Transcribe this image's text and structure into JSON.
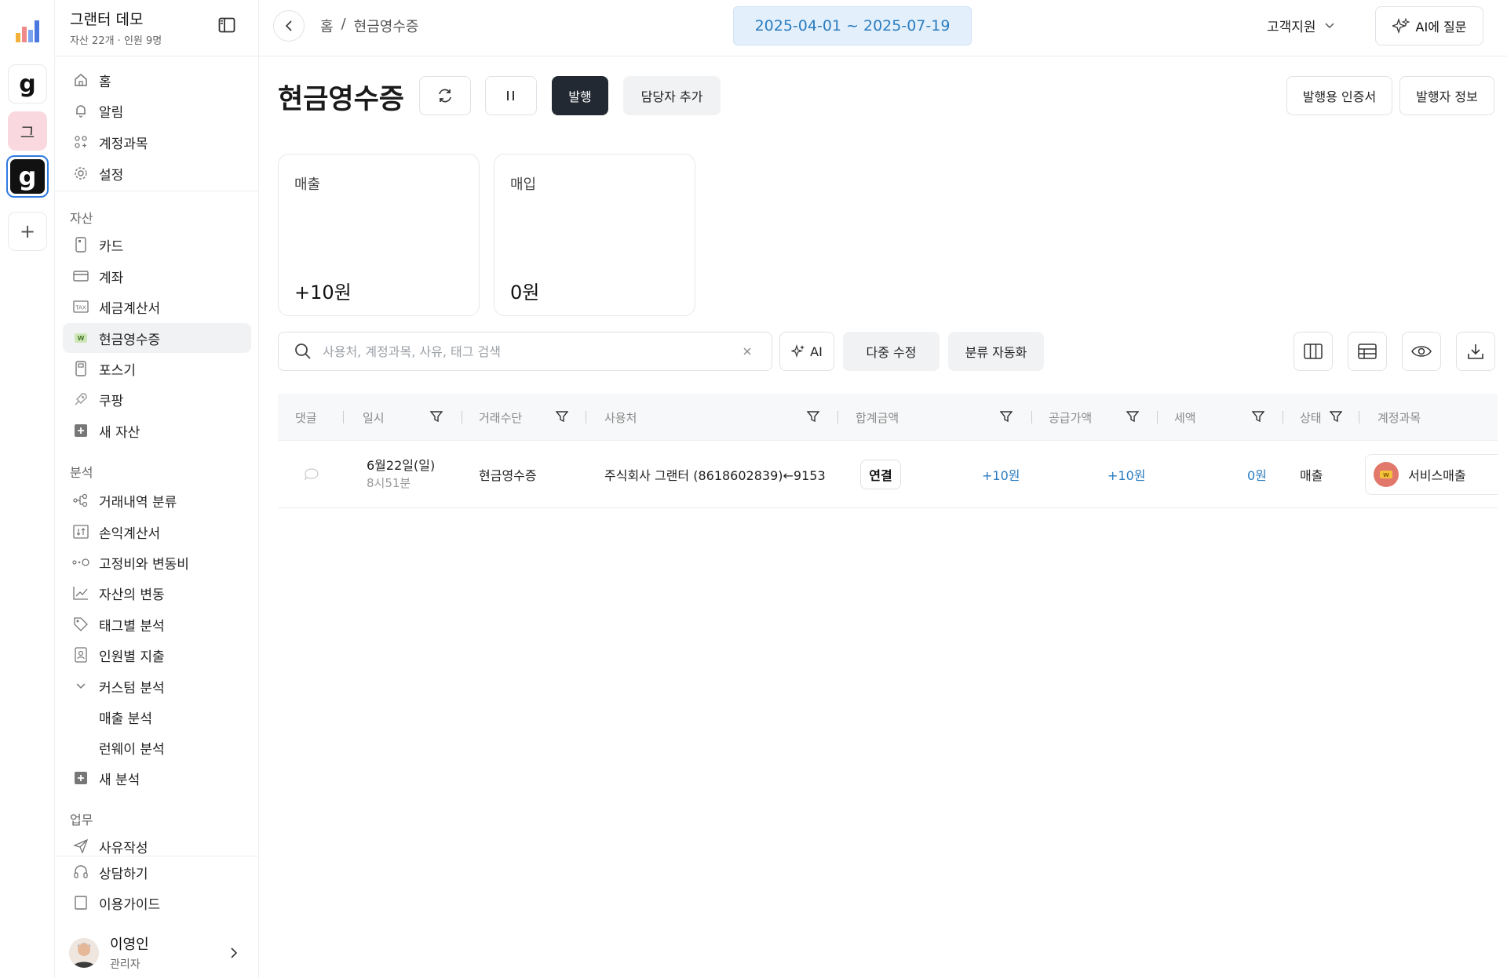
{
  "rail": {
    "org_initial_g": "g",
    "org_kor_initial": "그",
    "org_active_g": "g",
    "add": "+"
  },
  "sidebar": {
    "org_name": "그랜터 데모",
    "org_sub": "자산 22개 · 인원 9명",
    "top_items": [
      {
        "label": "홈",
        "icon": "home-icon"
      },
      {
        "label": "알림",
        "icon": "bell-icon"
      },
      {
        "label": "계정과목",
        "icon": "categories-icon"
      },
      {
        "label": "설정",
        "icon": "gear-icon"
      }
    ],
    "asset_title": "자산",
    "asset_items": [
      {
        "label": "카드",
        "icon": "card-icon"
      },
      {
        "label": "계좌",
        "icon": "bank-account-icon"
      },
      {
        "label": "세금계산서",
        "icon": "tax-invoice-icon"
      },
      {
        "label": "현금영수증",
        "icon": "cash-receipt-icon"
      },
      {
        "label": "포스기",
        "icon": "pos-icon"
      },
      {
        "label": "쿠팡",
        "icon": "rocket-icon"
      },
      {
        "label": "새 자산",
        "icon": "plus-square-icon"
      }
    ],
    "analysis_title": "분석",
    "analysis_items": [
      {
        "label": "거래내역 분류",
        "icon": "classify-icon"
      },
      {
        "label": "손익계산서",
        "icon": "income-statement-icon"
      },
      {
        "label": "고정비와 변동비",
        "icon": "fixed-variable-icon"
      },
      {
        "label": "자산의 변동",
        "icon": "trend-chart-icon"
      },
      {
        "label": "태그별 분석",
        "icon": "tag-icon"
      },
      {
        "label": "인원별 지출",
        "icon": "person-card-icon"
      },
      {
        "label": "커스텀 분석",
        "icon": "chevron-down-icon"
      },
      {
        "label": "매출 분석",
        "icon": ""
      },
      {
        "label": "런웨이 분석",
        "icon": ""
      },
      {
        "label": "새 분석",
        "icon": "plus-square-icon"
      }
    ],
    "work_title": "업무",
    "work_items": [
      {
        "label": "사유작성",
        "icon": "send-icon"
      }
    ],
    "bottom_items": [
      {
        "label": "상담하기",
        "icon": "headset-icon"
      },
      {
        "label": "이용가이드",
        "icon": "book-icon"
      }
    ],
    "user": {
      "name": "이영인",
      "role": "관리자"
    }
  },
  "topbar": {
    "breadcrumb_home": "홈",
    "breadcrumb_sep": "/",
    "breadcrumb_current": "현금영수증",
    "date_range": "2025-04-01 ~ 2025-07-19",
    "support": "고객지원",
    "ask_ai": "AI에 질문"
  },
  "header": {
    "title": "현금영수증",
    "issue": "발행",
    "add_manager": "담당자 추가",
    "issuing_cert": "발행용 인증서",
    "issuer_info": "발행자 정보"
  },
  "summary": {
    "sales_title": "매출",
    "sales_value": "+10원",
    "purchase_title": "매입",
    "purchase_value": "0원"
  },
  "toolbar": {
    "search_placeholder": "사용처, 계정과목, 사유, 태그 검색",
    "ai": "AI",
    "bulk_edit": "다중 수정",
    "auto_classify": "분류 자동화"
  },
  "table": {
    "columns": [
      "댓글",
      "일시",
      "거래수단",
      "사용처",
      "합계금액",
      "공급가액",
      "세액",
      "상태",
      "계정과목"
    ],
    "rows": [
      {
        "date": "6월22일(일)",
        "time": "8시51분",
        "method": "현금영수증",
        "merchant": "주식회사 그랜터 (8618602839)←9153",
        "link": "연결",
        "total": "+10원",
        "supply": "+10원",
        "tax": "0원",
        "status": "매출",
        "account": "서비스매출"
      }
    ]
  },
  "colors": {
    "accent_blue": "#2a7cc0",
    "date_bg": "#e3f0fb",
    "dark_button": "#222932",
    "selected_org_border": "#2f7be0"
  }
}
